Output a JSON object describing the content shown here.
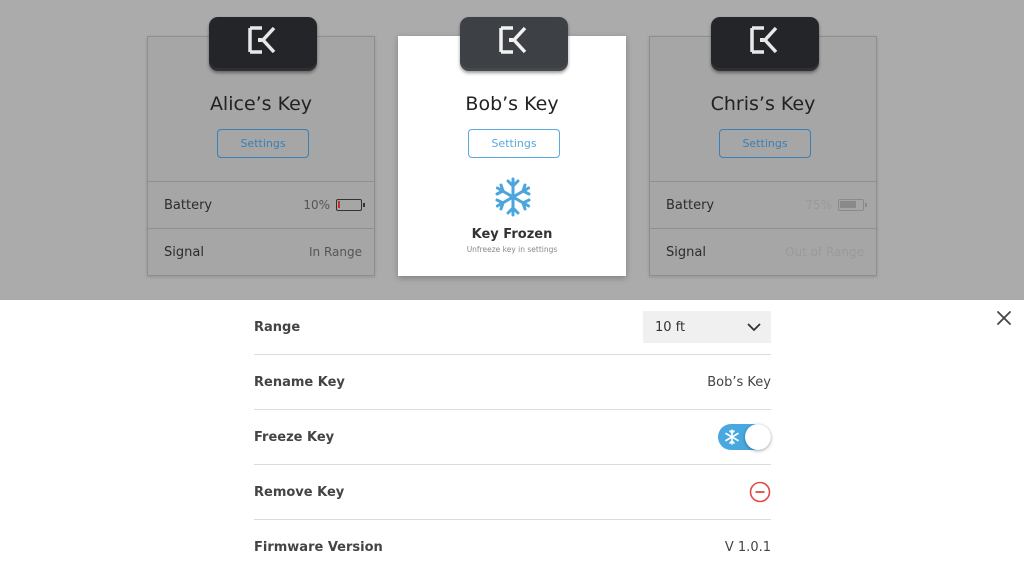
{
  "cards": [
    {
      "title": "Alice’s Key",
      "settings_label": "Settings",
      "battery_label": "Battery",
      "battery_value": "10%",
      "battery_level": 0.1,
      "signal_label": "Signal",
      "signal_value": "In Range"
    },
    {
      "title": "Bob’s Key",
      "settings_label": "Settings",
      "frozen_title": "Key Frozen",
      "frozen_subtitle": "Unfreeze key in settings"
    },
    {
      "title": "Chris’s Key",
      "settings_label": "Settings",
      "battery_label": "Battery",
      "battery_value": "75%",
      "battery_level": 0.75,
      "signal_label": "Signal",
      "signal_value": "Out of Range"
    }
  ],
  "settings": {
    "range_label": "Range",
    "range_value": "10 ft",
    "rename_label": "Rename Key",
    "rename_value": "Bob’s Key",
    "freeze_label": "Freeze Key",
    "freeze_on": true,
    "remove_label": "Remove Key",
    "firmware_label": "Firmware Version",
    "firmware_value": "V 1.0.1"
  },
  "colors": {
    "accent": "#48a8df",
    "danger": "#e04b45",
    "battery_low": "#c8302c"
  },
  "icons": {
    "device_logo": "ek-logo-icon",
    "frozen": "snowflake-icon",
    "close": "close-icon",
    "dropdown": "chevron-down-icon",
    "remove": "minus-circle-icon"
  }
}
